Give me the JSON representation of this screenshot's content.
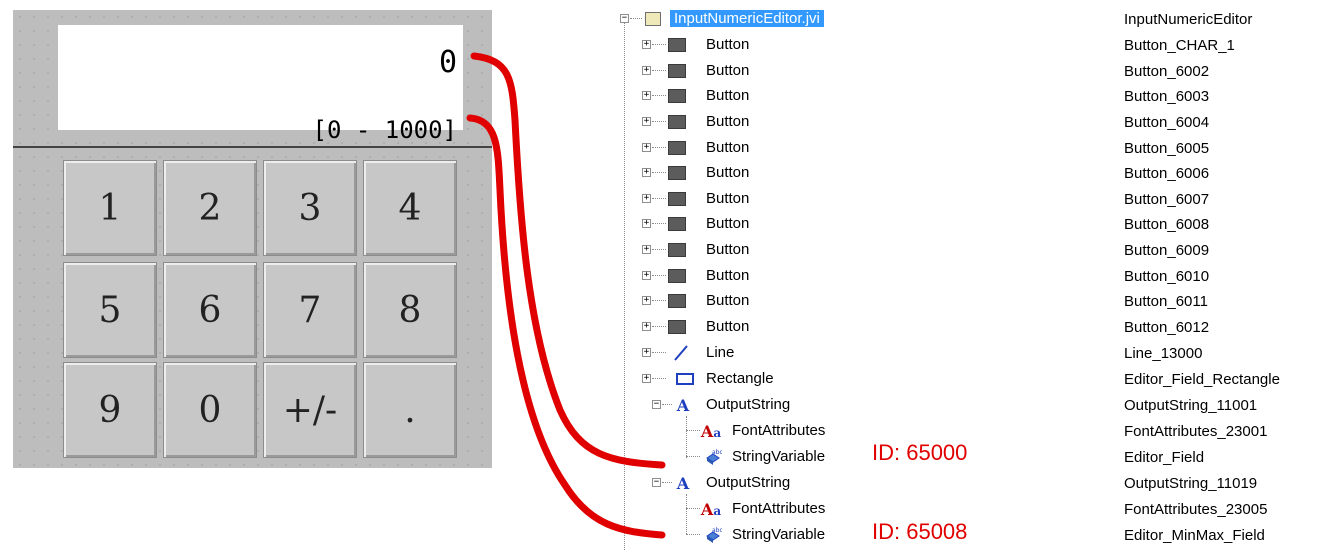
{
  "editor": {
    "value": "0",
    "range": "[0 - 1000]",
    "keys": [
      "1",
      "2",
      "3",
      "4",
      "5",
      "6",
      "7",
      "8",
      "9",
      "0",
      "+/-",
      "."
    ]
  },
  "tree": {
    "root": {
      "label": "InputNumericEditor.jvi",
      "name": "InputNumericEditor"
    },
    "items": [
      {
        "label": "Button",
        "name": "Button_CHAR_1",
        "icon": "button-icon"
      },
      {
        "label": "Button",
        "name": "Button_6002",
        "icon": "button-icon"
      },
      {
        "label": "Button",
        "name": "Button_6003",
        "icon": "button-icon"
      },
      {
        "label": "Button",
        "name": "Button_6004",
        "icon": "button-icon"
      },
      {
        "label": "Button",
        "name": "Button_6005",
        "icon": "button-icon"
      },
      {
        "label": "Button",
        "name": "Button_6006",
        "icon": "button-icon"
      },
      {
        "label": "Button",
        "name": "Button_6007",
        "icon": "button-icon"
      },
      {
        "label": "Button",
        "name": "Button_6008",
        "icon": "button-icon"
      },
      {
        "label": "Button",
        "name": "Button_6009",
        "icon": "button-icon"
      },
      {
        "label": "Button",
        "name": "Button_6010",
        "icon": "button-icon"
      },
      {
        "label": "Button",
        "name": "Button_6011",
        "icon": "button-icon"
      },
      {
        "label": "Button",
        "name": "Button_6012",
        "icon": "button-icon"
      },
      {
        "label": "Line",
        "name": "Line_13000",
        "icon": "line-icon"
      },
      {
        "label": "Rectangle",
        "name": "Editor_Field_Rectangle",
        "icon": "rectangle-icon"
      },
      {
        "label": "OutputString",
        "name": "OutputString_11001",
        "icon": "output-string-icon"
      },
      {
        "label": "FontAttributes",
        "name": "FontAttributes_23001",
        "icon": "font-attributes-icon"
      },
      {
        "label": "StringVariable",
        "name": "Editor_Field",
        "icon": "string-variable-icon"
      },
      {
        "label": "OutputString",
        "name": "OutputString_11019",
        "icon": "output-string-icon"
      },
      {
        "label": "FontAttributes",
        "name": "FontAttributes_23005",
        "icon": "font-attributes-icon"
      },
      {
        "label": "StringVariable",
        "name": "Editor_MinMax_Field",
        "icon": "string-variable-icon"
      }
    ]
  },
  "annotations": {
    "id_value_field": "ID: 65000",
    "id_minmax_field": "ID: 65008",
    "connector_color": "#e00000"
  },
  "colors": {
    "selection": "#3399ff",
    "panel_bg": "#bdbdbd",
    "icon_blue": "#1f3fbf"
  }
}
